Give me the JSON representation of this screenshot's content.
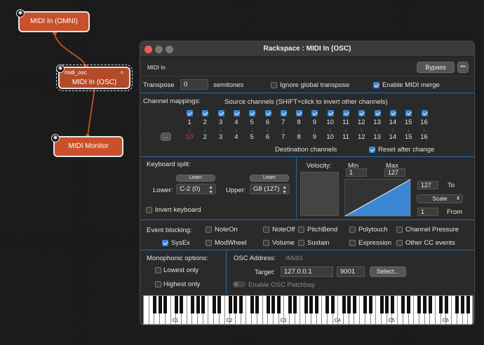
{
  "graph": {
    "nodes": [
      {
        "label": "MIDI In (OMNI)"
      },
      {
        "sublabel": "midi_osc",
        "label": "MIDI In (OSC)"
      },
      {
        "label": "MIDI Monitor"
      }
    ]
  },
  "window": {
    "title": "Rackspace : MIDI In (OSC)",
    "header_label": "MIDI In",
    "bypass_label": "Bypass",
    "more_label": "•••",
    "transpose": {
      "label": "Transpose",
      "value": "0",
      "unit": "semitones",
      "ignore_global": "Ignore global transpose",
      "ignore_global_checked": false,
      "enable_midi_merge": "Enable MIDI merge",
      "enable_midi_merge_checked": true
    },
    "channel_mappings": {
      "label": "Channel mappings:",
      "source_label": "Source channels (SHIFT+click to invert other channels)",
      "source": [
        "1",
        "2",
        "3",
        "4",
        "5",
        "6",
        "7",
        "8",
        "9",
        "10",
        "11",
        "12",
        "13",
        "14",
        "15",
        "16"
      ],
      "destination": [
        "10",
        "2",
        "3",
        "4",
        "5",
        "6",
        "7",
        "8",
        "9",
        "10",
        "11",
        "12",
        "13",
        "14",
        "15",
        "16"
      ],
      "highlight_source_index": 0,
      "dest_label": "Destination channels",
      "reset_label": "Reset after change",
      "reset_checked": true,
      "more_button": "..."
    },
    "keyboard_split": {
      "label": "Keyboard split:",
      "lower_label": "Lower:",
      "lower_value": "C-2 (0)",
      "upper_label": "Upper:",
      "upper_value": "G8 (127)",
      "learn_label": "Learn",
      "invert_label": "Invert keyboard",
      "invert_checked": false
    },
    "velocity": {
      "label": "Velocity:",
      "min_label": "Min",
      "min_value": "1",
      "max_label": "Max",
      "max_value": "127",
      "to_value": "127",
      "to_label": "To",
      "scale_label": "Scale",
      "from_value": "1",
      "from_label": "From"
    },
    "event_blocking": {
      "label": "Event blocking:",
      "items": [
        {
          "label": "NoteOn",
          "checked": false
        },
        {
          "label": "NoteOff",
          "checked": false
        },
        {
          "label": "PitchBend",
          "checked": false
        },
        {
          "label": "Polytouch",
          "checked": false
        },
        {
          "label": "Channel Pressure",
          "checked": false
        },
        {
          "label": "SysEx",
          "checked": true
        },
        {
          "label": "ModWheel",
          "checked": false
        },
        {
          "label": "Volume",
          "checked": false
        },
        {
          "label": "Sustain",
          "checked": false
        },
        {
          "label": "Expression",
          "checked": false
        },
        {
          "label": "Other CC events",
          "checked": false
        }
      ]
    },
    "monophonic": {
      "label": "Monophonic options:",
      "lowest": "Lowest only",
      "highest": "Highest only"
    },
    "osc": {
      "address_label": "OSC Address:",
      "address_value": "/Midi1",
      "target_label": "Target:",
      "ip": "127.0.0.1",
      "port": "9001",
      "select_label": "Select...",
      "patchbay_label": "Enable OSC Patchbay"
    },
    "keyboard": {
      "octave_labels": [
        "C1",
        "C2",
        "C3",
        "C4",
        "C5",
        "C6"
      ]
    }
  },
  "colors": {
    "node": "#c8502a",
    "accent": "#3b87d6",
    "highlight": "#e0433b"
  }
}
